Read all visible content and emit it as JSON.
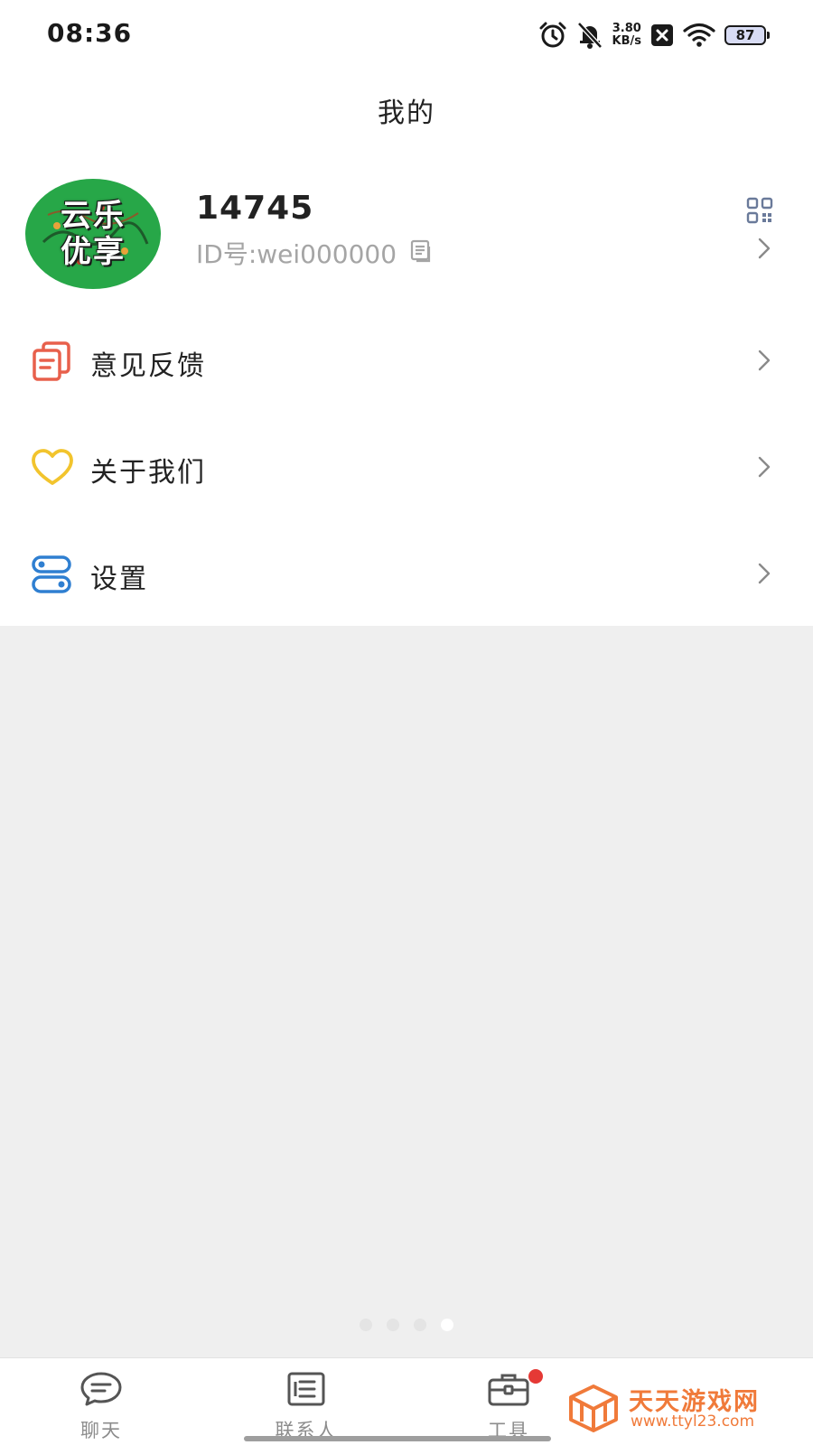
{
  "status_bar": {
    "time": "08:36",
    "net_speed_value": "3.80",
    "net_speed_unit": "KB/s",
    "battery": "87",
    "icons": [
      "alarm-icon",
      "bell-muted-icon",
      "close-box-icon",
      "wifi-icon",
      "battery-icon"
    ]
  },
  "header": {
    "title": "我的"
  },
  "profile": {
    "avatar_line1": "云乐",
    "avatar_line2": "优享",
    "username": "14745",
    "user_id": "ID号:wei000000",
    "icons": [
      "copy-icon",
      "qr-code-icon",
      "chevron-right-icon"
    ]
  },
  "menu": {
    "items": [
      {
        "label": "意见反馈",
        "icon": "feedback-icon",
        "color": "#e8604c"
      },
      {
        "label": "关于我们",
        "icon": "heart-icon",
        "color": "#f2c42d"
      },
      {
        "label": "设置",
        "icon": "settings-icon",
        "color": "#2f7fd1"
      }
    ]
  },
  "pager": {
    "count": 4,
    "active_index": 3
  },
  "bottom_nav": {
    "items": [
      {
        "label": "聊天",
        "icon": "chat-icon"
      },
      {
        "label": "联系人",
        "icon": "contacts-icon"
      },
      {
        "label": "工具",
        "icon": "toolbox-icon",
        "badge": true
      }
    ]
  },
  "watermark": {
    "title": "天天游戏网",
    "url": "www.ttyl23.com",
    "color": "#f07a3a"
  }
}
